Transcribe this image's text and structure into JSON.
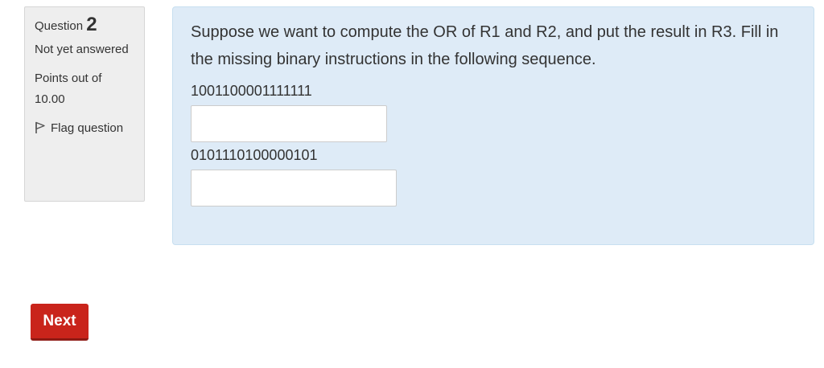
{
  "info": {
    "question_prefix": "Question",
    "question_number": "2",
    "state": "Not yet answered",
    "grade": "Points out of 10.00",
    "flag_label": "Flag question",
    "flag_icon": "flag-icon"
  },
  "question": {
    "text": "Suppose we want to compute the OR of R1 and R2, and put the result in R3.  Fill in the missing binary instructions in the following sequence.",
    "binary_1": "1001100001111111",
    "answer_1_value": "",
    "binary_2": "0101110100000101",
    "answer_2_value": ""
  },
  "navigation": {
    "next_label": "Next"
  },
  "colors": {
    "info_panel_bg": "#eeeeee",
    "content_panel_bg": "#deebf7",
    "next_button_bg": "#c9241b"
  }
}
